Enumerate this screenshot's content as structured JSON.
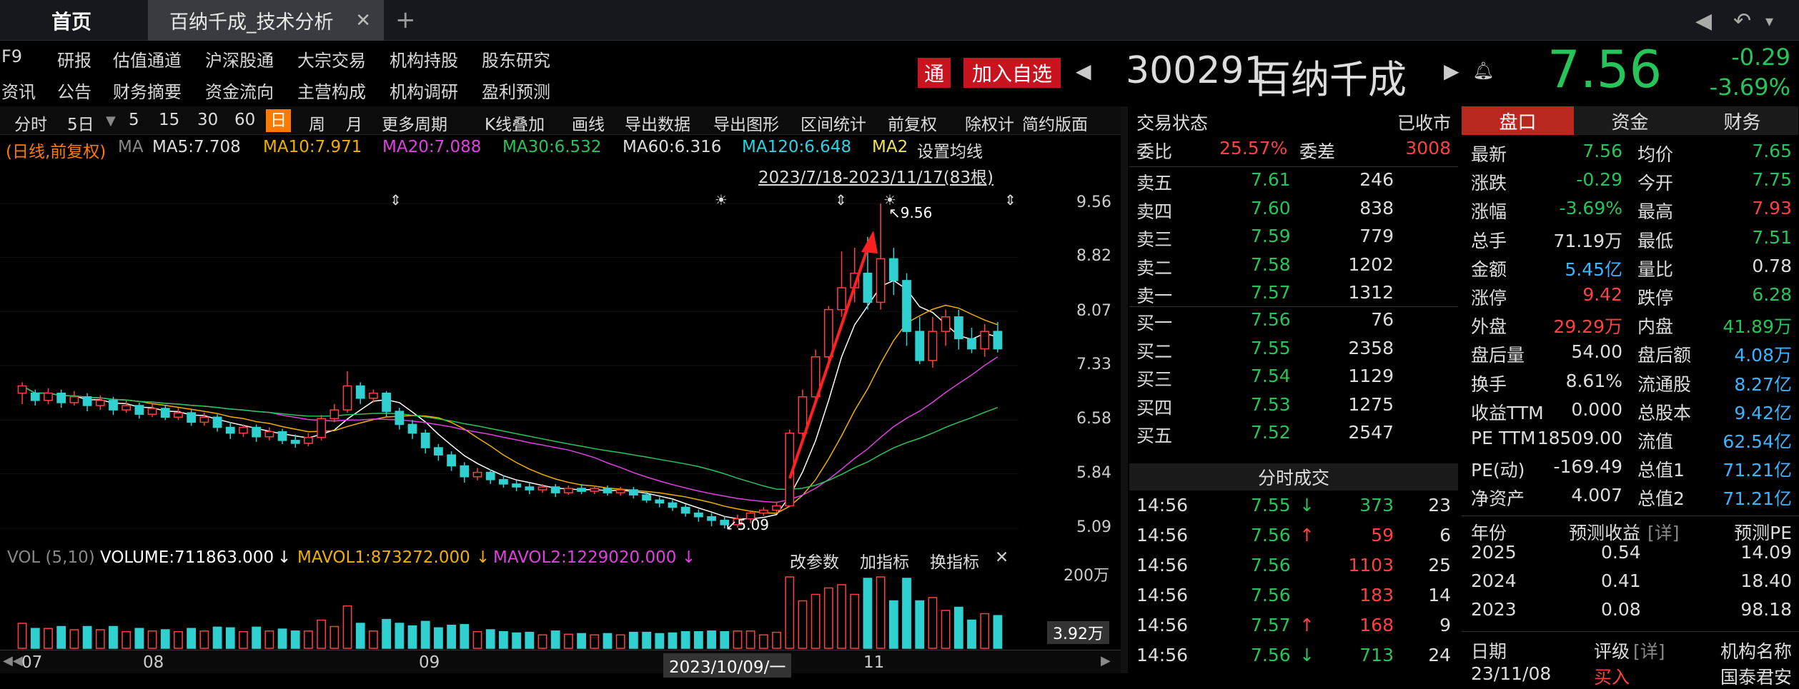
{
  "tabs": {
    "home": "首页",
    "active": "百纳千成_技术分析",
    "plus": "+"
  },
  "menu": {
    "row1": [
      "F9",
      "研报",
      "估值通道",
      "沪深股通",
      "大宗交易",
      "机构持股",
      "股东研究"
    ],
    "row2": [
      "资讯",
      "公告",
      "财务摘要",
      "资金流向",
      "主营构成",
      "机构调研",
      "盈利预测"
    ]
  },
  "header": {
    "tong": "通",
    "add": "加入自选",
    "code": "300291",
    "name": "百纳千成",
    "price": "7.56",
    "change": "-0.29",
    "pct": "-3.69%"
  },
  "toolbar": [
    "分时",
    "5日",
    "5",
    "15",
    "30",
    "60",
    "日",
    "周",
    "月",
    "更多周期",
    "K线叠加",
    "画线",
    "导出数据",
    "导出图形",
    "区间统计",
    "前复权",
    "除权计",
    "简约版面"
  ],
  "ma": {
    "mode": "(日线,前复权)",
    "label": "MA",
    "ma5": "MA5:7.708",
    "ma10": "MA10:7.971",
    "ma20": "MA20:7.088",
    "ma30": "MA30:6.532",
    "ma60": "MA60:6.316",
    "ma120": "MA120:6.648",
    "ma2": "MA2",
    "setting": "设置均线",
    "range": "2023/7/18-2023/11/17(83根)"
  },
  "chart_data": {
    "type": "candlestick",
    "title": "",
    "ylim": [
      5.09,
      9.56
    ],
    "yticks": [
      "9.56",
      "8.82",
      "8.07",
      "7.33",
      "6.58",
      "5.84",
      "5.09"
    ],
    "high_label": "9.56",
    "low_label": "5.09",
    "xlabels": [
      "07",
      "08",
      "09",
      "2023/10/09/一",
      "11"
    ],
    "candles": [
      [
        6.95,
        7.05,
        7.1,
        6.8
      ],
      [
        6.95,
        6.85,
        7.0,
        6.78
      ],
      [
        6.85,
        6.95,
        7.02,
        6.8
      ],
      [
        6.95,
        6.82,
        7.0,
        6.75
      ],
      [
        6.82,
        6.9,
        6.98,
        6.78
      ],
      [
        6.9,
        6.78,
        6.95,
        6.7
      ],
      [
        6.78,
        6.85,
        6.92,
        6.72
      ],
      [
        6.85,
        6.72,
        6.9,
        6.65
      ],
      [
        6.72,
        6.78,
        6.85,
        6.68
      ],
      [
        6.78,
        6.66,
        6.82,
        6.6
      ],
      [
        6.66,
        6.74,
        6.8,
        6.62
      ],
      [
        6.74,
        6.62,
        6.78,
        6.58
      ],
      [
        6.62,
        6.68,
        6.75,
        6.58
      ],
      [
        6.68,
        6.55,
        6.72,
        6.5
      ],
      [
        6.55,
        6.62,
        6.68,
        6.5
      ],
      [
        6.62,
        6.48,
        6.66,
        6.42
      ],
      [
        6.48,
        6.4,
        6.55,
        6.32
      ],
      [
        6.4,
        6.48,
        6.52,
        6.35
      ],
      [
        6.48,
        6.35,
        6.52,
        6.28
      ],
      [
        6.35,
        6.42,
        6.48,
        6.3
      ],
      [
        6.42,
        6.3,
        6.46,
        6.25
      ],
      [
        6.3,
        6.26,
        6.38,
        6.2
      ],
      [
        6.26,
        6.34,
        6.4,
        6.22
      ],
      [
        6.34,
        6.6,
        6.65,
        6.3
      ],
      [
        6.6,
        6.72,
        6.8,
        6.55
      ],
      [
        6.72,
        7.05,
        7.25,
        6.68
      ],
      [
        7.05,
        6.88,
        7.1,
        6.8
      ],
      [
        6.88,
        6.95,
        7.0,
        6.82
      ],
      [
        6.95,
        6.7,
        6.98,
        6.62
      ],
      [
        6.7,
        6.52,
        6.75,
        6.45
      ],
      [
        6.52,
        6.4,
        6.58,
        6.32
      ],
      [
        6.4,
        6.2,
        6.45,
        6.12
      ],
      [
        6.2,
        6.1,
        6.25,
        6.02
      ],
      [
        6.1,
        5.95,
        6.15,
        5.88
      ],
      [
        5.95,
        5.8,
        6.0,
        5.72
      ],
      [
        5.8,
        5.86,
        5.92,
        5.75
      ],
      [
        5.86,
        5.76,
        5.9,
        5.7
      ],
      [
        5.76,
        5.7,
        5.82,
        5.65
      ],
      [
        5.7,
        5.66,
        5.75,
        5.6
      ],
      [
        5.66,
        5.62,
        5.72,
        5.56
      ],
      [
        5.62,
        5.66,
        5.7,
        5.58
      ],
      [
        5.66,
        5.58,
        5.7,
        5.52
      ],
      [
        5.58,
        5.64,
        5.68,
        5.55
      ],
      [
        5.64,
        5.6,
        5.7,
        5.56
      ],
      [
        5.6,
        5.64,
        5.68,
        5.56
      ],
      [
        5.64,
        5.58,
        5.68,
        5.54
      ],
      [
        5.58,
        5.62,
        5.66,
        5.54
      ],
      [
        5.62,
        5.55,
        5.66,
        5.5
      ],
      [
        5.55,
        5.48,
        5.6,
        5.44
      ],
      [
        5.48,
        5.44,
        5.52,
        5.38
      ],
      [
        5.44,
        5.38,
        5.48,
        5.33
      ],
      [
        5.38,
        5.3,
        5.42,
        5.25
      ],
      [
        5.3,
        5.25,
        5.35,
        5.18
      ],
      [
        5.25,
        5.2,
        5.3,
        5.12
      ],
      [
        5.2,
        5.14,
        5.26,
        5.09
      ],
      [
        5.14,
        5.22,
        5.28,
        5.1
      ],
      [
        5.22,
        5.3,
        5.34,
        5.16
      ],
      [
        5.3,
        5.34,
        5.38,
        5.26
      ],
      [
        5.34,
        5.4,
        5.46,
        5.3
      ],
      [
        5.4,
        6.4,
        6.45,
        5.38
      ],
      [
        6.4,
        6.9,
        7.0,
        6.35
      ],
      [
        6.9,
        7.45,
        7.55,
        6.8
      ],
      [
        7.45,
        8.1,
        8.15,
        7.3
      ],
      [
        8.1,
        8.4,
        8.9,
        8.0
      ],
      [
        8.4,
        8.6,
        8.95,
        8.2
      ],
      [
        8.6,
        8.2,
        9.1,
        8.1
      ],
      [
        8.2,
        8.8,
        9.56,
        8.1
      ],
      [
        8.8,
        8.5,
        8.95,
        8.3
      ],
      [
        8.5,
        7.8,
        8.6,
        7.6
      ],
      [
        7.8,
        7.4,
        8.0,
        7.35
      ],
      [
        7.4,
        7.8,
        8.0,
        7.3
      ],
      [
        7.8,
        8.0,
        8.1,
        7.6
      ],
      [
        8.0,
        7.7,
        8.1,
        7.55
      ],
      [
        7.7,
        7.56,
        7.85,
        7.5
      ],
      [
        7.56,
        7.8,
        7.9,
        7.45
      ],
      [
        7.8,
        7.56,
        7.93,
        7.51
      ]
    ],
    "volume": {
      "label": "VOL (5,10)",
      "volume": "VOLUME:711863.000",
      "mavol1": "MAVOL1:873272.000",
      "mavol2": "MAVOL2:1229020.000",
      "ytick": "200万",
      "cur": "3.92万"
    }
  },
  "vol": {
    "params": "改参数",
    "add": "加指标",
    "swap": "换指标"
  },
  "orderbook": {
    "title": "交易状态",
    "status": "已收市",
    "weibi": "委比",
    "weibi_v": "25.57%",
    "weicha": "委差",
    "weicha_v": "3008",
    "sells": [
      [
        "卖五",
        "7.61",
        "246"
      ],
      [
        "卖四",
        "7.60",
        "838"
      ],
      [
        "卖三",
        "7.59",
        "779"
      ],
      [
        "卖二",
        "7.58",
        "1202"
      ],
      [
        "卖一",
        "7.57",
        "1312"
      ]
    ],
    "buys": [
      [
        "买一",
        "7.56",
        "76"
      ],
      [
        "买二",
        "7.55",
        "2358"
      ],
      [
        "买三",
        "7.54",
        "1129"
      ],
      [
        "买四",
        "7.53",
        "1275"
      ],
      [
        "买五",
        "7.52",
        "2547"
      ]
    ],
    "ticks_title": "分时成交",
    "ticks": [
      [
        "14:56",
        "7.55",
        "↓",
        "373",
        "23"
      ],
      [
        "14:56",
        "7.56",
        "↑",
        "59",
        "6"
      ],
      [
        "14:56",
        "7.56",
        "",
        "1103",
        "25"
      ],
      [
        "14:56",
        "7.56",
        "",
        "183",
        "14"
      ],
      [
        "14:56",
        "7.57",
        "↑",
        "168",
        "9"
      ],
      [
        "14:56",
        "7.56",
        "↓",
        "713",
        "24"
      ]
    ]
  },
  "quote": {
    "tabs": [
      "盘口",
      "资金",
      "财务"
    ],
    "rows": [
      [
        "最新",
        "7.56",
        "均价",
        "7.65"
      ],
      [
        "涨跌",
        "-0.29",
        "今开",
        "7.75"
      ],
      [
        "涨幅",
        "-3.69%",
        "最高",
        "7.93"
      ],
      [
        "总手",
        "71.19万",
        "最低",
        "7.51"
      ],
      [
        "金额",
        "5.45亿",
        "量比",
        "0.78"
      ],
      [
        "涨停",
        "9.42",
        "跌停",
        "6.28"
      ],
      [
        "外盘",
        "29.29万",
        "内盘",
        "41.89万"
      ],
      [
        "盘后量",
        "54.00",
        "盘后额",
        "4.08万"
      ],
      [
        "换手",
        "8.61%",
        "流通股",
        "8.27亿"
      ],
      [
        "收益TTM",
        "0.000",
        "总股本",
        "9.42亿"
      ],
      [
        "PE TTM",
        "18509.00",
        "流值",
        "62.54亿"
      ],
      [
        "PE(动)",
        "-169.49",
        "总值1",
        "71.21亿"
      ],
      [
        "净资产",
        "4.007",
        "总值2",
        "71.21亿"
      ]
    ],
    "fc_head": [
      "年份",
      "预测收益",
      "[详]",
      "预测PE"
    ],
    "fc": [
      [
        "2025",
        "0.54",
        "14.09"
      ],
      [
        "2024",
        "0.41",
        "18.40"
      ],
      [
        "2023",
        "0.08",
        "98.18"
      ]
    ],
    "rating_head": [
      "日期",
      "评级",
      "[详]",
      "机构名称"
    ],
    "rating_row": [
      "23/11/08",
      "买入",
      "国泰君安"
    ]
  },
  "colors": {
    "up": "#ff4040",
    "down": "#27c45a",
    "accent": "#ff7a00"
  }
}
